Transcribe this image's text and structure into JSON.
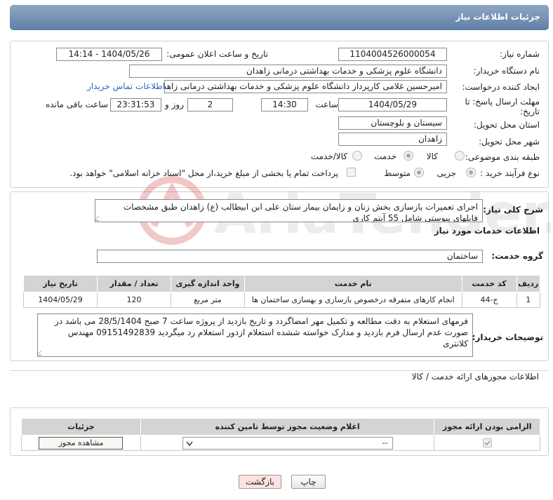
{
  "header": {
    "title": "جزئیات اطلاعات نیاز"
  },
  "form": {
    "need_number_label": "شماره نیاز:",
    "need_number": "1104004526000054",
    "announce_label": "تاریخ و ساعت اعلان عمومی:",
    "announce_value": "1404/05/26 - 14:14",
    "buyer_org_label": "نام دستگاه خریدار:",
    "buyer_org": "دانشگاه علوم پزشکی و خدمات بهداشتی درمانی زاهدان",
    "creator_label": "ایجاد کننده درخواست:",
    "creator": "امیرحسین غلامی کارپرداز دانشگاه علوم پزشکی و خدمات بهداشتی درمانی زاهدان",
    "contact_link": "اطلاعات تماس خریدار",
    "deadline_label_1": "مهلت ارسال پاسخ: تا",
    "deadline_label_2": "تاریخ:",
    "deadline_date": "1404/05/29",
    "time_label": "ساعت",
    "deadline_time": "14:30",
    "days_value": "2",
    "days_label": "روز و",
    "remaining_time": "23:31:53",
    "remaining_label": "ساعت باقی مانده",
    "province_label": "استان محل تحویل:",
    "province": "سیستان و بلوچستان",
    "city_label": "شهر محل تحویل:",
    "city": "زاهدان",
    "category_label": "طبقه بندی موضوعی:",
    "category_options": [
      "کالا",
      "خدمت",
      "کالا/خدمت"
    ],
    "category_selected": "خدمت",
    "process_label": "نوع فرآیند خرید :",
    "process_options": [
      "جزیی",
      "متوسط"
    ],
    "process_selected": "جزیی",
    "treasury_note": "پرداخت تمام یا بخشی از مبلغ خرید،از محل \"اسناد خزانه اسلامی\" خواهد بود."
  },
  "description": {
    "label": "شرح کلی نیاز:",
    "text": "اجرای تعمیرات بازسازی بخش زنان و زایمان بیمار ستان  علی ابن ابیطالب (ع) زاهدان طبق مشخصات فایلهای پیوستی شامل 55 آیتم کاری"
  },
  "services": {
    "section_title": "اطلاعات خدمات مورد نیاز",
    "group_label": "گروه خدمت:",
    "group_value": "ساختمان",
    "columns": [
      "ردیف",
      "کد خدمت",
      "نام خدمت",
      "واحد اندازه گیری",
      "تعداد / مقدار",
      "تاریخ نیاز"
    ],
    "rows": [
      [
        "1",
        "ج-44",
        "انجام کارهای متفرقه درخصوص بازسازی و بهسازی ساختمان ها",
        "متر مربع",
        "120",
        "1404/05/29"
      ]
    ]
  },
  "buyer_notes": {
    "label": "توضیحات خریدار:",
    "text": "فرمهای استعلام به دقت مطالعه و تکمیل مهر امضاگردد  و تاریخ بازدید از پروژه ساعت 7 صبح 28/5/1404 می باشد  در صورت عدم ارسال فرم بازدید و مدارک خواسته ششده استعلام ازدور استعلام رد میگردید 09151492839 مهندس کلانتری"
  },
  "permits": {
    "section_title": "اطلاعات مجوزهای ارائه خدمت / کالا",
    "columns": [
      "الزامی بودن ارائه مجوز",
      "اعلام وضعیت مجوز توسط تامین کننده",
      "جزئیات"
    ],
    "select_value": "--",
    "view_button": "مشاهده مجوز"
  },
  "footer": {
    "print_button": "چاپ",
    "back_button": "بازگشت"
  },
  "watermark": {
    "text": "AriaTender.net"
  },
  "colors": {
    "header_bg": "#6f8db2",
    "link": "#2a66c4",
    "back_button_bg": "#fde2e2",
    "table_header": "#d4d4d4"
  }
}
